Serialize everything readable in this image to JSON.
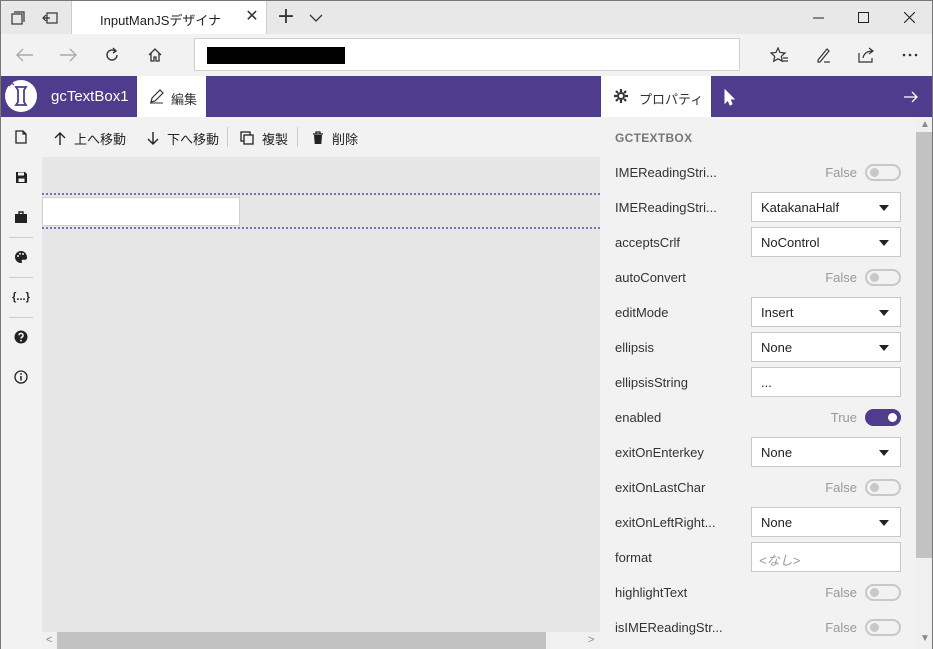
{
  "browser": {
    "tab_title": "InputManJSデザイナ",
    "tab_close": "✕",
    "new_tab": "+"
  },
  "app": {
    "component_name": "gcTextBox1",
    "edit_tab_label": "編集",
    "properties_tab_label": "プロパティ",
    "sidebar_brackets": "{...}"
  },
  "toolbar": {
    "move_up": "上へ移動",
    "move_down": "下へ移動",
    "duplicate": "複製",
    "delete": "削除"
  },
  "properties": {
    "header": "GCTEXTBOX",
    "rows": [
      {
        "name": "IMEReadingStri...",
        "type": "bool",
        "value": "False",
        "on": false
      },
      {
        "name": "IMEReadingStri...",
        "type": "select",
        "value": "KatakanaHalf"
      },
      {
        "name": "acceptsCrlf",
        "type": "select",
        "value": "NoControl"
      },
      {
        "name": "autoConvert",
        "type": "bool",
        "value": "False",
        "on": false
      },
      {
        "name": "editMode",
        "type": "select",
        "value": "Insert"
      },
      {
        "name": "ellipsis",
        "type": "select",
        "value": "None"
      },
      {
        "name": "ellipsisString",
        "type": "text",
        "value": "..."
      },
      {
        "name": "enabled",
        "type": "bool",
        "value": "True",
        "on": true
      },
      {
        "name": "exitOnEnterkey",
        "type": "select",
        "value": "None"
      },
      {
        "name": "exitOnLastChar",
        "type": "bool",
        "value": "False",
        "on": false
      },
      {
        "name": "exitOnLeftRight...",
        "type": "select",
        "value": "None"
      },
      {
        "name": "format",
        "type": "text",
        "value": "",
        "placeholder": "<なし>"
      },
      {
        "name": "highlightText",
        "type": "bool",
        "value": "False",
        "on": false
      },
      {
        "name": "isIMEReadingStr...",
        "type": "bool",
        "value": "False",
        "on": false
      }
    ]
  },
  "colors": {
    "accent": "#503c8c",
    "canvas": "#e6e6e6",
    "panel": "#f2f2f2"
  }
}
